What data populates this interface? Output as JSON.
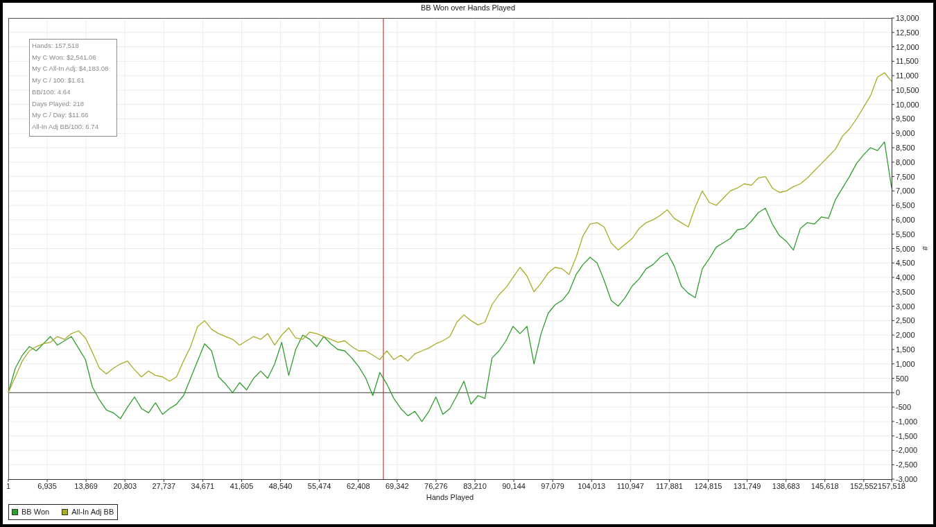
{
  "chart": {
    "stats_box": {
      "lines": [
        "Hands: 157,518",
        "My C Won: $2,541.08",
        "My C All-In Adj: $4,183.08",
        "My C / 100: $1.61",
        "BB/100: 4.64",
        "Days Played: 218",
        "My C / Day: $11.66",
        "All-In Adj BB/100: 6.74"
      ]
    },
    "chart_data": {
      "type": "line",
      "title": "BB Won over Hands Played",
      "xlabel": "Hands Played",
      "ylabel": "#",
      "grid": true,
      "legend": "lower left",
      "x": [
        1,
        1250,
        2500,
        3750,
        5000,
        6250,
        7500,
        8750,
        10000,
        11250,
        12500,
        13750,
        15000,
        16250,
        17500,
        18750,
        20000,
        21250,
        22500,
        23750,
        25000,
        26250,
        27500,
        28750,
        30000,
        31250,
        32500,
        33750,
        35000,
        36250,
        37500,
        38750,
        40000,
        41250,
        42500,
        43750,
        45000,
        46250,
        47500,
        48750,
        50000,
        51250,
        52500,
        53750,
        55000,
        56250,
        57500,
        58750,
        60000,
        61250,
        62500,
        63750,
        65000,
        66250,
        67500,
        68750,
        70000,
        71250,
        72500,
        73750,
        75000,
        76250,
        77500,
        78750,
        80000,
        81250,
        82500,
        83750,
        85000,
        86250,
        87500,
        88750,
        90000,
        91250,
        92500,
        93750,
        95000,
        96250,
        97500,
        98750,
        100000,
        101250,
        102500,
        103750,
        105000,
        106250,
        107500,
        108750,
        110000,
        111250,
        112500,
        113750,
        115000,
        116250,
        117500,
        118750,
        120000,
        121250,
        122500,
        123750,
        125000,
        126250,
        127500,
        128750,
        130000,
        131250,
        132500,
        133750,
        135000,
        136250,
        137500,
        138750,
        140000,
        141250,
        142500,
        143750,
        145000,
        146250,
        147500,
        148750,
        150000,
        151250,
        152500,
        153750,
        155000,
        156250,
        157518
      ],
      "series": [
        {
          "name": "BB Won",
          "color": "#2e9e2e",
          "values": [
            0,
            850,
            1300,
            1600,
            1450,
            1700,
            1950,
            1650,
            1800,
            1950,
            1550,
            1150,
            200,
            -250,
            -600,
            -700,
            -900,
            -500,
            -150,
            -550,
            -700,
            -350,
            -750,
            -550,
            -400,
            -100,
            500,
            1100,
            1700,
            1450,
            550,
            300,
            0,
            350,
            100,
            500,
            750,
            500,
            1000,
            1750,
            600,
            1500,
            2000,
            1850,
            1600,
            1950,
            1700,
            1500,
            1450,
            1200,
            900,
            500,
            -100,
            700,
            300,
            -200,
            -550,
            -800,
            -650,
            -1000,
            -650,
            -150,
            -750,
            -550,
            -100,
            400,
            -400,
            -100,
            -200,
            1200,
            1450,
            1800,
            2300,
            2050,
            2300,
            1000,
            2050,
            2750,
            3050,
            3200,
            3500,
            4100,
            4450,
            4700,
            4500,
            3900,
            3200,
            3000,
            3300,
            3700,
            3950,
            4300,
            4450,
            4700,
            4850,
            4400,
            3700,
            3450,
            3300,
            4300,
            4650,
            5050,
            5200,
            5350,
            5650,
            5700,
            5950,
            6250,
            6400,
            5850,
            5450,
            5250,
            4950,
            5700,
            5900,
            5850,
            6100,
            6050,
            6700,
            7100,
            7500,
            7950,
            8250,
            8500,
            8400,
            8700,
            7100
          ]
        },
        {
          "name": "All-In Adj BB",
          "color": "#a9ab25",
          "values": [
            0,
            550,
            1100,
            1450,
            1600,
            1700,
            1750,
            1950,
            1850,
            2050,
            2150,
            1900,
            1400,
            850,
            650,
            850,
            1000,
            1100,
            800,
            550,
            750,
            600,
            550,
            400,
            550,
            1100,
            1600,
            2300,
            2500,
            2200,
            2050,
            1950,
            1850,
            1650,
            1800,
            1950,
            1850,
            2050,
            1650,
            2000,
            2250,
            1900,
            1850,
            2100,
            2050,
            1950,
            1850,
            1750,
            1800,
            1600,
            1450,
            1450,
            1300,
            1150,
            1450,
            1150,
            1300,
            1100,
            1350,
            1450,
            1550,
            1700,
            1800,
            1950,
            2450,
            2700,
            2500,
            2350,
            2450,
            3050,
            3400,
            3650,
            4000,
            4350,
            4050,
            3500,
            3800,
            4150,
            4350,
            4300,
            4100,
            4700,
            5450,
            5850,
            5900,
            5750,
            5200,
            4950,
            5150,
            5350,
            5700,
            5900,
            6000,
            6150,
            6350,
            6050,
            5900,
            5750,
            6450,
            7000,
            6600,
            6500,
            6750,
            7000,
            7100,
            7250,
            7200,
            7450,
            7500,
            7100,
            6950,
            7000,
            7150,
            7250,
            7450,
            7700,
            7950,
            8200,
            8450,
            8900,
            9150,
            9500,
            9900,
            10300,
            10950,
            11100,
            10800
          ]
        }
      ],
      "xlim": [
        1,
        157518
      ],
      "ylim": [
        -3000,
        13000
      ],
      "xticks": [
        {
          "value": 1,
          "label": "1"
        },
        {
          "value": 6935,
          "label": "6,935"
        },
        {
          "value": 13869,
          "label": "13,869"
        },
        {
          "value": 20803,
          "label": "20,803"
        },
        {
          "value": 27737,
          "label": "27,737"
        },
        {
          "value": 34671,
          "label": "34,671"
        },
        {
          "value": 41605,
          "label": "41,605"
        },
        {
          "value": 48540,
          "label": "48,540"
        },
        {
          "value": 55474,
          "label": "55,474"
        },
        {
          "value": 62408,
          "label": "62,408"
        },
        {
          "value": 69342,
          "label": "69,342"
        },
        {
          "value": 76276,
          "label": "76,276"
        },
        {
          "value": 83210,
          "label": "83,210"
        },
        {
          "value": 90144,
          "label": "90,144"
        },
        {
          "value": 97079,
          "label": "97,079"
        },
        {
          "value": 104013,
          "label": "104,013"
        },
        {
          "value": 110947,
          "label": "110,947"
        },
        {
          "value": 117881,
          "label": "117,881"
        },
        {
          "value": 124815,
          "label": "124,815"
        },
        {
          "value": 131749,
          "label": "131,749"
        },
        {
          "value": 138683,
          "label": "138,683"
        },
        {
          "value": 145618,
          "label": "145,618"
        },
        {
          "value": 152552,
          "label": "152,552"
        },
        {
          "value": 157518,
          "label": "157,518"
        }
      ],
      "yticks": [
        {
          "value": 13000,
          "label": "13,000"
        },
        {
          "value": 12500,
          "label": "12,500"
        },
        {
          "value": 12000,
          "label": "12,000"
        },
        {
          "value": 11500,
          "label": "11,500"
        },
        {
          "value": 11000,
          "label": "11,000"
        },
        {
          "value": 10500,
          "label": "10,500"
        },
        {
          "value": 10000,
          "label": "10,000"
        },
        {
          "value": 9500,
          "label": "9,500"
        },
        {
          "value": 9000,
          "label": "9,000"
        },
        {
          "value": 8500,
          "label": "8,500"
        },
        {
          "value": 8000,
          "label": "8,000"
        },
        {
          "value": 7500,
          "label": "7,500"
        },
        {
          "value": 7000,
          "label": "7,000"
        },
        {
          "value": 6500,
          "label": "6,500"
        },
        {
          "value": 6000,
          "label": "6,000"
        },
        {
          "value": 5500,
          "label": "5,500"
        },
        {
          "value": 5000,
          "label": "5,000"
        },
        {
          "value": 4500,
          "label": "4,500"
        },
        {
          "value": 4000,
          "label": "4,000"
        },
        {
          "value": 3500,
          "label": "3,500"
        },
        {
          "value": 3000,
          "label": "3,000"
        },
        {
          "value": 2500,
          "label": "2,500"
        },
        {
          "value": 2000,
          "label": "2,000"
        },
        {
          "value": 1500,
          "label": "1,500"
        },
        {
          "value": 1000,
          "label": "1,000"
        },
        {
          "value": 500,
          "label": "500"
        },
        {
          "value": 0,
          "label": "0"
        },
        {
          "value": -500,
          "label": "-500"
        },
        {
          "value": -1000,
          "label": "-1,000"
        },
        {
          "value": -1500,
          "label": "-1,500"
        },
        {
          "value": -2000,
          "label": "-2,000"
        },
        {
          "value": -2500,
          "label": "-2,500"
        },
        {
          "value": -3000,
          "label": "-3,000"
        }
      ],
      "ref_lines": [
        {
          "axis": "x",
          "value": 66890
        }
      ]
    }
  }
}
